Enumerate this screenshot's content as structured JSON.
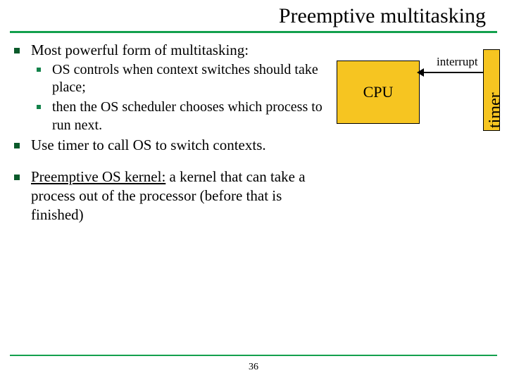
{
  "title": "Preemptive multitasking",
  "bullets": {
    "b1": "Most powerful form of multitasking:",
    "b1a": "OS controls when context switches should take place;",
    "b1b": "then the OS scheduler chooses which process to run next.",
    "b2": "Use timer to call OS to switch contexts.",
    "b3_prefix": "Preemptive OS kernel:",
    "b3_rest": " a kernel that can take a process out of the processor (before that is finished)"
  },
  "figure": {
    "cpu": "CPU",
    "timer": "timer",
    "interrupt": "interrupt"
  },
  "page": "36"
}
